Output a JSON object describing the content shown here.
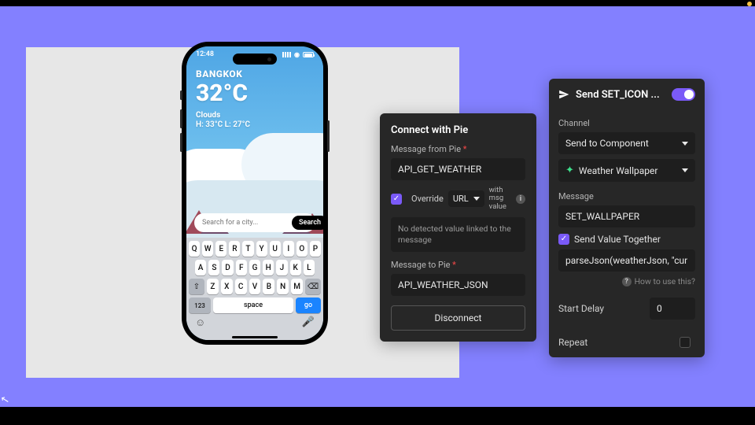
{
  "phone": {
    "time": "12:48",
    "city": "BANGKOK",
    "temperature": "32°C",
    "condition": "Clouds",
    "high_low": "H: 33°C    L: 27°C",
    "search_placeholder": "Search for a city...",
    "search_button": "Search",
    "keyboard": {
      "row1": [
        "Q",
        "W",
        "E",
        "R",
        "T",
        "Y",
        "U",
        "I",
        "O",
        "P"
      ],
      "row2": [
        "A",
        "S",
        "D",
        "F",
        "G",
        "H",
        "J",
        "K",
        "L"
      ],
      "row3_shift": "⇧",
      "row3": [
        "Z",
        "X",
        "C",
        "V",
        "B",
        "N",
        "M"
      ],
      "row3_back": "⌫",
      "num_key": "123",
      "space_key": "space",
      "go_key": "go",
      "emoji": "☺",
      "mic": "🎤"
    }
  },
  "connect": {
    "title": "Connect with Pie",
    "message_from_label": "Message from Pie",
    "message_from_value": "API_GET_WEATHER",
    "override_label": "Override",
    "override_checked": true,
    "override_type": "URL",
    "with_msg_value": "with msg value",
    "no_detected": "No detected value linked to the message",
    "message_to_label": "Message to Pie",
    "message_to_value": "API_WEATHER_JSON",
    "disconnect": "Disconnect"
  },
  "send": {
    "title": "Send SET_ICON ...",
    "enabled": true,
    "channel_label": "Channel",
    "channel_value": "Send to Component",
    "component_value": "Weather Wallpaper",
    "message_label": "Message",
    "message_value": "SET_WALLPAPER",
    "send_value_together": "Send Value Together",
    "send_value_checked": true,
    "expression": "parseJson(weatherJson, \"curre",
    "how_to_use": "How to use this?",
    "start_delay_label": "Start Delay",
    "start_delay_value": "0",
    "repeat_label": "Repeat",
    "repeat_checked": false
  },
  "colors": {
    "canvas": "#8380ff",
    "panel": "#272727",
    "accent": "#7a5af8"
  }
}
